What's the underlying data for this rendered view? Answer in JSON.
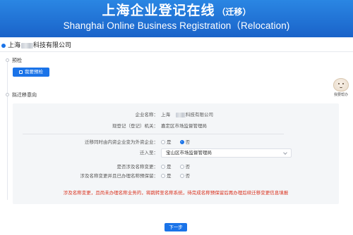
{
  "banner": {
    "title_cn": "上海企业登记在线",
    "title_suffix": "（迁移）",
    "title_en": "Shanghai Online Business Registration（Relocation)"
  },
  "company_header": {
    "name_prefix": "上海",
    "name_suffix": "科技有限公司"
  },
  "sections": {
    "precheck": {
      "title": "预检",
      "button_label": "我要预检"
    },
    "intent": {
      "title": "拟迁移意向"
    }
  },
  "helper": {
    "label": "我要帮办"
  },
  "form": {
    "company_name_label": "企业名称：",
    "company_name_prefix": "上海",
    "company_name_suffix": "科技有限公司",
    "authority_label": "现登记（登记）机关：",
    "authority_value": "嘉定区市场监督管理局",
    "foreign_change_label": "迁移同时由内资企业变为外资企业：",
    "foreign_change_options": [
      "是",
      "否"
    ],
    "foreign_change_selected": "否",
    "move_to_label": "迁入至：",
    "move_to_value": "宝山区市场监督管理局",
    "name_change_label": "是否涉及名称变更：",
    "name_change_options": [
      "是",
      "否"
    ],
    "name_change_selected": "否",
    "name_reserved_label": "涉及名称变更并且已办理名称预保留：",
    "name_reserved_options": [
      "是",
      "否"
    ],
    "name_reserved_selected": "否",
    "warning_text": "涉及名称变更，且尚未办理名称业务的，将跳转至名称系统，待完成名称预保留后再办理后续迁移变更信息填报"
  },
  "footer": {
    "next_label": "下一步"
  },
  "colors": {
    "banner": "#1a6fd6",
    "accent": "#1a73e8",
    "warning": "#d9301c",
    "panel": "#f4f6f8"
  }
}
